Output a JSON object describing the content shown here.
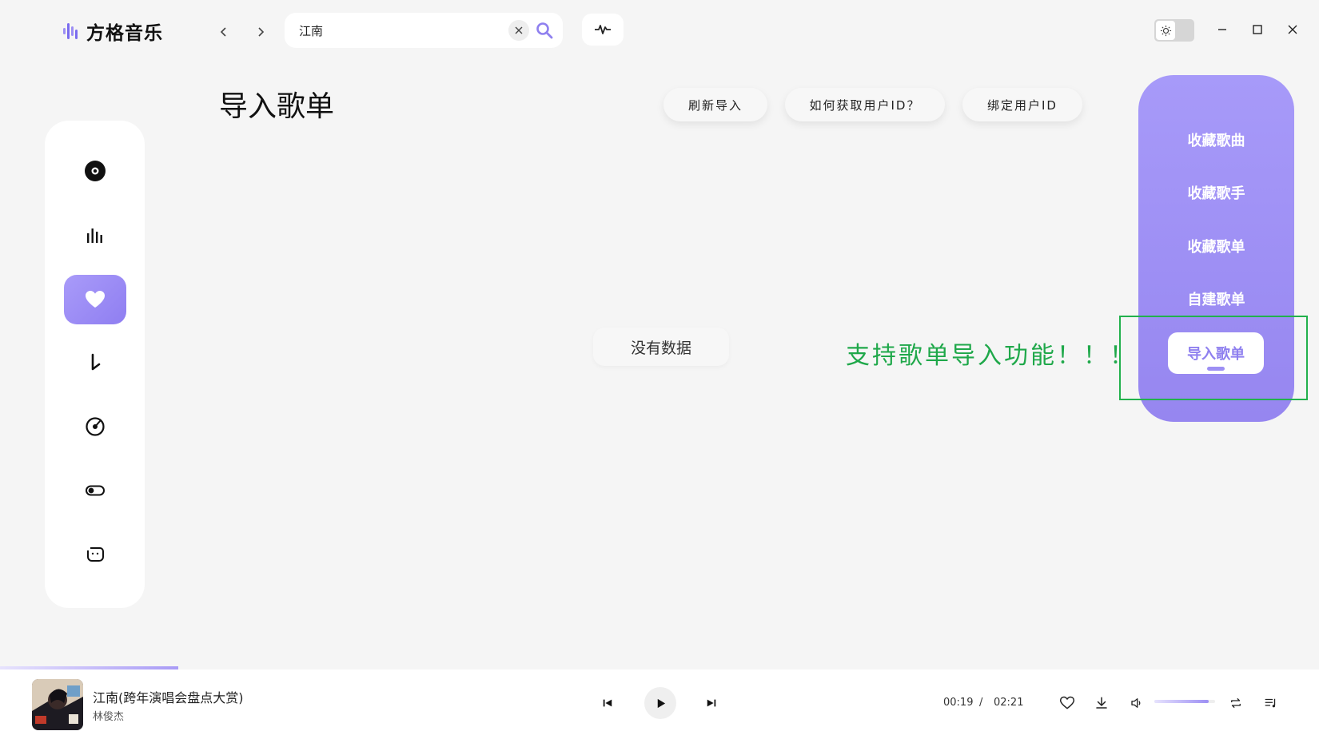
{
  "app": {
    "name": "方格音乐"
  },
  "search": {
    "value": "江南",
    "placeholder": ""
  },
  "page": {
    "title": "导入歌单",
    "empty_text": "没有数据"
  },
  "actions": [
    {
      "label": "刷新导入"
    },
    {
      "label": "如何获取用户ID？"
    },
    {
      "label": "绑定用户ID"
    }
  ],
  "sidebar": {
    "items": [
      {
        "icon": "disc-icon",
        "active": false
      },
      {
        "icon": "chart-bars-icon",
        "active": false
      },
      {
        "icon": "heart-icon",
        "active": true
      },
      {
        "icon": "download-arrow-icon",
        "active": false
      },
      {
        "icon": "vinyl-icon",
        "active": false
      },
      {
        "icon": "toggle-icon",
        "active": false
      },
      {
        "icon": "chat-icon",
        "active": false
      }
    ]
  },
  "right_tabs": {
    "items": [
      {
        "label": "收藏歌曲"
      },
      {
        "label": "收藏歌手"
      },
      {
        "label": "收藏歌单"
      },
      {
        "label": "自建歌单"
      },
      {
        "label": "导入歌单"
      }
    ],
    "active_index": 4
  },
  "annotation": {
    "text": "支持歌单导入功能！！！",
    "color": "#22b14c"
  },
  "player": {
    "title": "江南(跨年演唱会盘点大赏)",
    "artist": "林俊杰",
    "current_time": "00:19",
    "separator": "/",
    "total_time": "02:21",
    "progress": 0.135,
    "volume": 0.9
  },
  "colors": {
    "accent": "#9d8ff4",
    "accent_dark": "#8f80ef",
    "annotation_green": "#1fa84a"
  }
}
